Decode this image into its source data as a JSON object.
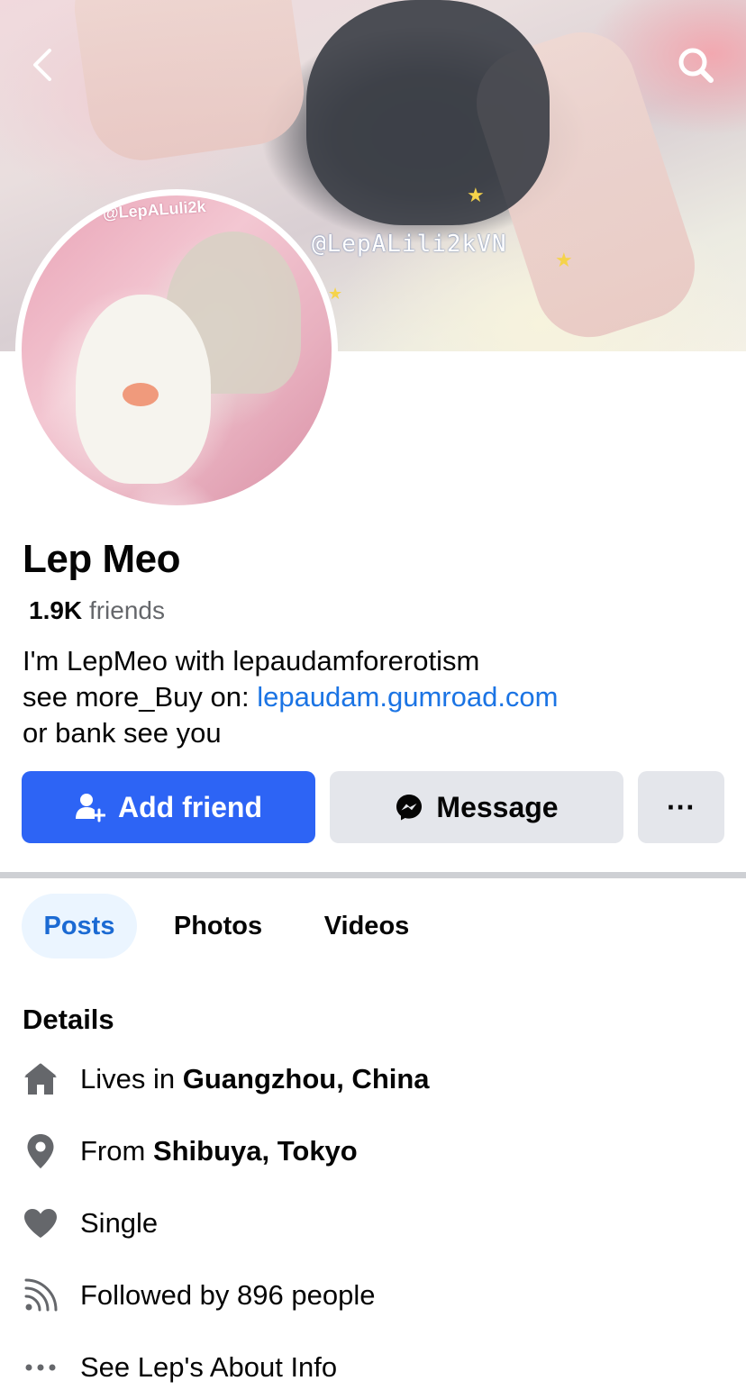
{
  "cover": {
    "watermark": "@LepALili2kVN"
  },
  "avatar": {
    "watermark": "@LepALuli2k"
  },
  "profile": {
    "name": "Lep Meo",
    "friends_count": "1.9K",
    "friends_label": "friends",
    "bio_line1": "I'm LepMeo with lepaudamforerotism",
    "bio_line2_prefix": "see more_Buy on: ",
    "bio_link": "lepaudam.gumroad.com",
    "bio_line3": "or bank see you"
  },
  "actions": {
    "add_friend": "Add friend",
    "message": "Message",
    "more": "···"
  },
  "tabs": [
    {
      "label": "Posts",
      "active": true
    },
    {
      "label": "Photos",
      "active": false
    },
    {
      "label": "Videos",
      "active": false
    }
  ],
  "details": {
    "title": "Details",
    "items": [
      {
        "icon": "home-icon",
        "prefix": "Lives in ",
        "value": "Guangzhou, China"
      },
      {
        "icon": "location-pin-icon",
        "prefix": "From ",
        "value": "Shibuya, Tokyo"
      },
      {
        "icon": "heart-icon",
        "prefix": "Single",
        "value": ""
      },
      {
        "icon": "rss-feed-icon",
        "prefix": "Followed by 896 people",
        "value": ""
      },
      {
        "icon": "ellipsis-icon",
        "prefix": "See Lep's About Info",
        "value": ""
      }
    ]
  },
  "colors": {
    "primary_button": "#2d64f5",
    "link": "#1b74e4",
    "active_tab_bg": "#ebf5ff",
    "active_tab_text": "#1b6ad3",
    "secondary_button": "#e4e6eb",
    "icon_gray": "#65676b"
  }
}
